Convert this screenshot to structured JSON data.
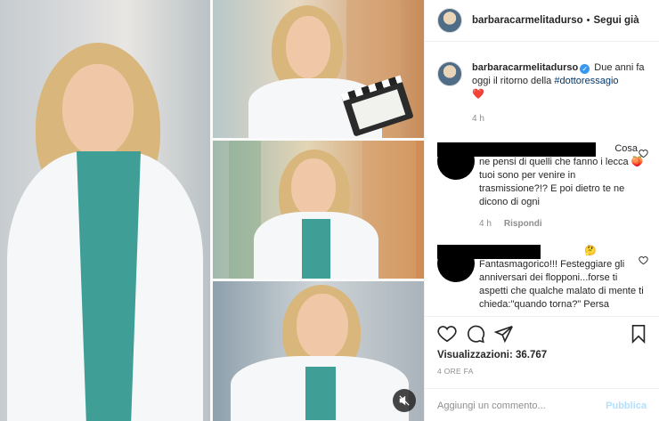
{
  "post": {
    "username": "barbaracarmelitadurso",
    "separator": "•",
    "follow_label": "Segui già"
  },
  "caption": {
    "username": "barbaracarmelitadurso",
    "text": " Due anni fa oggi il ritorno della ",
    "hashtag": "#dottoressagio",
    "emoji": "❤️",
    "time": "4 h"
  },
  "comments": [
    {
      "text_line1_suffix": "Cosa",
      "text": "ne pensi di quelli che fanno i lecca 🍑 tuoi sono per venire in trasmissione?!? E poi dietro te ne dicono di ogni",
      "time": "4 h",
      "reply_label": "Rispondi"
    },
    {
      "emoji": "🤔",
      "text": "Fantasmagorico!!! Festeggiare gli anniversari dei flopponi...forse ti aspetti che qualche malato di mente ti chieda:\"quando torna?\" Persa"
    }
  ],
  "stats": {
    "views": "Visualizzazioni: 36.767",
    "posted_ago": "4 ORE FA"
  },
  "add_comment": {
    "placeholder": "Aggiungi un commento...",
    "publish_label": "Pubblica"
  },
  "colors": {
    "link": "#00376b",
    "verified": "#3897f0",
    "publish_disabled": "#b2dffc",
    "muted": "#8e8e8e"
  },
  "icons": [
    "heart-icon",
    "comment-icon",
    "share-icon",
    "bookmark-icon",
    "sound-off-icon",
    "verified-badge-icon"
  ]
}
